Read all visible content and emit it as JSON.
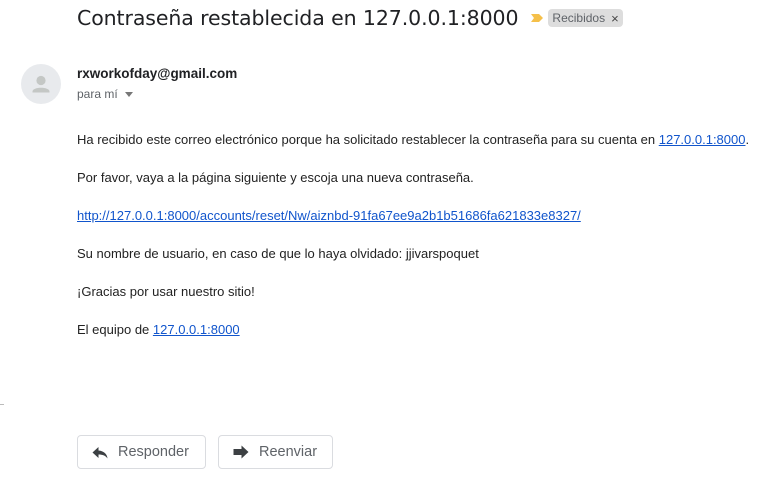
{
  "email": {
    "subject": "Contraseña restablecida en 127.0.0.1:8000",
    "label": "Recibidos",
    "label_remove": "×",
    "sender": "rxworkofday@gmail.com",
    "recipient": "para mí",
    "body": {
      "line1_prefix": "Ha recibido este correo electrónico porque ha solicitado restablecer la contraseña para su cuenta en ",
      "line1_link": "127.0.0.1:8000",
      "line1_suffix": ".",
      "line2": "Por favor, vaya a la página siguiente y escoja una nueva contraseña.",
      "reset_link": "http://127.0.0.1:8000/accounts/reset/Nw/aiznbd-91fa67ee9a2b1b51686fa621833e8327/",
      "line4": "Su nombre de usuario, en caso de que lo haya olvidado: jjivarspoquet",
      "line5": "¡Gracias por usar nuestro sitio!",
      "signature_prefix": "El equipo de ",
      "signature_link": "127.0.0.1:8000"
    }
  },
  "actions": {
    "reply_label": "Responder",
    "forward_label": "Reenviar"
  },
  "icons": {
    "importance": "importance-marker-icon",
    "avatar": "default-person-icon",
    "recipient_details": "caret-down-icon",
    "reply": "reply-arrow-icon",
    "forward": "forward-arrow-icon"
  },
  "colors": {
    "importance": "#f5c04a",
    "link": "#1155cc",
    "label_bg": "#dddddd"
  }
}
